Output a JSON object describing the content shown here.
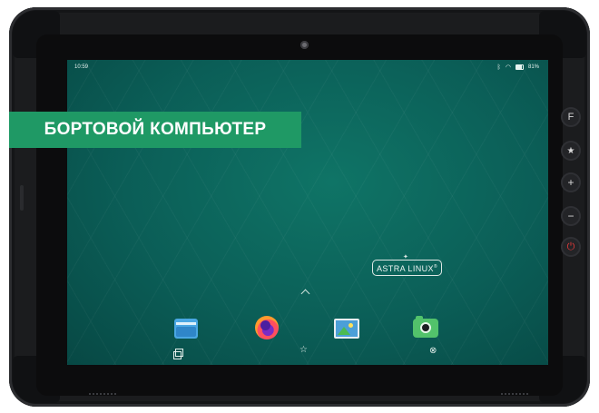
{
  "status_bar": {
    "time": "10:59",
    "battery": "81%"
  },
  "promo": {
    "text": "БОРТОВОЙ КОМПЬЮТЕР"
  },
  "wallpaper": {
    "logo_text": "ASTRA LINUX",
    "logo_mark": "®"
  },
  "dock": {
    "apps": [
      "files",
      "firefox",
      "images",
      "camera"
    ]
  },
  "navbar": {
    "home_glyph": "☆",
    "close_glyph": "⊗"
  },
  "side_buttons": {
    "f": "F",
    "star": "★",
    "plus": "+",
    "minus": "−",
    "power": "⏻"
  },
  "colors": {
    "banner": "#1f9965",
    "screen": "#0b5e57",
    "power": "#e63a3a"
  }
}
